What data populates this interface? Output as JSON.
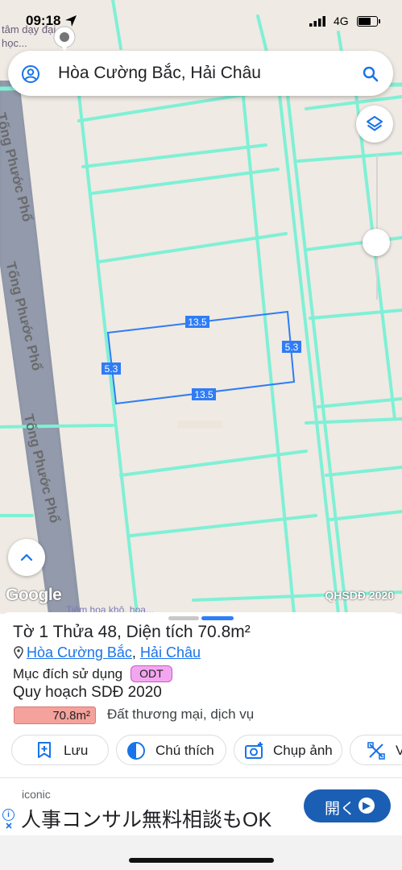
{
  "status_bar": {
    "time": "09:18",
    "network": "4G"
  },
  "search": {
    "query": "Hòa Cường Bắc, Hải Châu"
  },
  "map": {
    "street_name": "Tống Phước Phổ",
    "poi_top": "tâm dạy đại học...",
    "poi_bottom": "Tiệm hoa khô, hoa...",
    "plan_label": "QHSDĐ 2020",
    "google_logo": "Google",
    "parcel_dimensions": {
      "top": "13.5",
      "bottom": "13.5",
      "left": "5.3",
      "right": "5.3"
    },
    "colors": {
      "road_grid": "#7ff0d6",
      "parcel_outline": "#2f7cf6",
      "main_road": "#8e96a8"
    }
  },
  "parcel": {
    "title": "Tờ 1 Thửa 48, Diện tích 70.8m²",
    "ward": "Hòa Cường Bắc",
    "district": "Hải Châu",
    "purpose_label": "Mục đích sử dụng",
    "purpose_code": "ODT",
    "plan_title": "Quy hoạch SDĐ 2020",
    "plan_area": "70.8m²",
    "plan_use": "Đất thương mại, dịch vụ"
  },
  "actions": [
    {
      "label": "Lưu",
      "icon": "bookmark-add-icon"
    },
    {
      "label": "Chú thích",
      "icon": "contrast-icon"
    },
    {
      "label": "Chụp ảnh",
      "icon": "camera-add-icon"
    },
    {
      "label": "V",
      "icon": "ruler-cross-icon"
    }
  ],
  "ad": {
    "brand": "iconic",
    "copy": "人事コンサル無料相談もOK",
    "button": "開く"
  }
}
